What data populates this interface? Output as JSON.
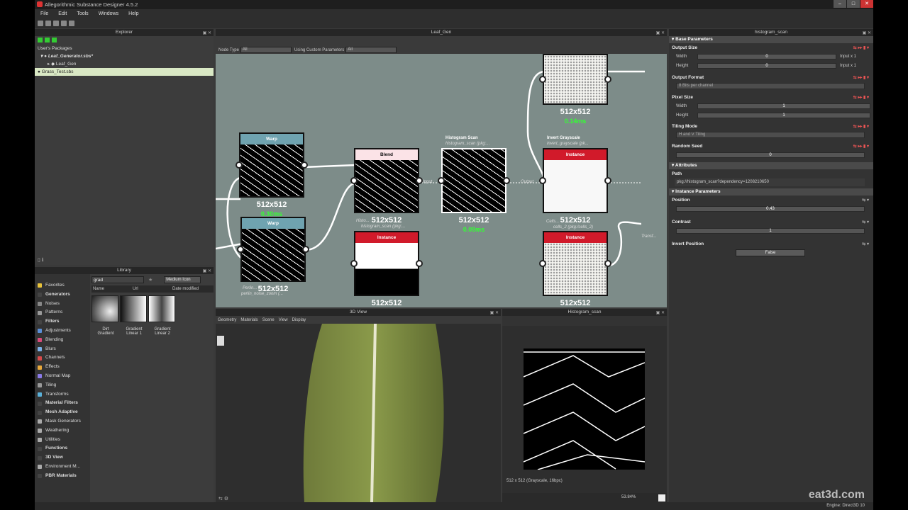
{
  "window": {
    "title": "Allegorithmic Substance Designer 4.5.2"
  },
  "menu": [
    "File",
    "Edit",
    "Tools",
    "Windows",
    "Help"
  ],
  "explorer": {
    "title": "Explorer",
    "section": "User's Packages",
    "items": [
      "Leaf_Generator.sbs*",
      "Leaf_Gen",
      "Grass_Test.sbs"
    ]
  },
  "library": {
    "title": "Library",
    "search_value": "grad",
    "view_mode": "Medium Icon",
    "columns": [
      "Name",
      "Url",
      "Date modified"
    ],
    "thumbs": [
      {
        "label": "Dirt Gradient"
      },
      {
        "label": "Gradient Linear 1"
      },
      {
        "label": "Gradient Linear 2"
      }
    ],
    "categories": [
      {
        "label": "Favorites",
        "bold": false,
        "color": "#e8c23a"
      },
      {
        "label": "Generators",
        "bold": true,
        "color": "#444"
      },
      {
        "label": "Noises",
        "bold": false,
        "color": "#888"
      },
      {
        "label": "Patterns",
        "bold": false,
        "color": "#999"
      },
      {
        "label": "Filters",
        "bold": true,
        "color": "#444"
      },
      {
        "label": "Adjustments",
        "bold": false,
        "color": "#5a8fd8"
      },
      {
        "label": "Blending",
        "bold": false,
        "color": "#d84a7a"
      },
      {
        "label": "Blurs",
        "bold": false,
        "color": "#7ab0e8"
      },
      {
        "label": "Channels",
        "bold": false,
        "color": "#d84a4a"
      },
      {
        "label": "Effects",
        "bold": false,
        "color": "#e8a83a"
      },
      {
        "label": "Normal Map",
        "bold": false,
        "color": "#8a7ae8"
      },
      {
        "label": "Tiling",
        "bold": false,
        "color": "#999"
      },
      {
        "label": "Transforms",
        "bold": false,
        "color": "#5ab0d8"
      },
      {
        "label": "Material Filters",
        "bold": true,
        "color": "#444"
      },
      {
        "label": "Mesh Adaptive",
        "bold": true,
        "color": "#444"
      },
      {
        "label": "Mask Generators",
        "bold": false,
        "color": "#aaa"
      },
      {
        "label": "Weathering",
        "bold": false,
        "color": "#aaa"
      },
      {
        "label": "Utilities",
        "bold": false,
        "color": "#aaa"
      },
      {
        "label": "Functions",
        "bold": true,
        "color": "#444"
      },
      {
        "label": "3D View",
        "bold": true,
        "color": "#444"
      },
      {
        "label": "Environment M...",
        "bold": false,
        "color": "#aaa"
      },
      {
        "label": "PBR Materials",
        "bold": true,
        "color": "#444"
      }
    ]
  },
  "graph": {
    "title": "Leaf_Gen",
    "filter_label": "Node Type",
    "filter_value": "All",
    "custom_label": "Using Custom Parameters",
    "custom_value": "All",
    "nodes": [
      {
        "title": "Warp",
        "size": "512x512",
        "time": "0.30ms"
      },
      {
        "title": "Warp",
        "size": "512x512"
      },
      {
        "title": "Blend",
        "size": "512x512"
      },
      {
        "title": "Instance",
        "size": "512x512"
      },
      {
        "label": "Histogram Scan",
        "sub": "histogram_scan (pkg:...",
        "size": "512x512",
        "time": "0.09ms"
      },
      {
        "label": "Invert Grayscale",
        "sub": "invert_grayscale (pk...",
        "title": "Instance",
        "size": "512x512"
      },
      {
        "title": "Instance",
        "size": "512x512"
      },
      {
        "size": "512x512",
        "time": "0.14ms"
      }
    ],
    "misc_labels": [
      "Histo...",
      "histogram_scan (pkg:...",
      "Perlin...",
      "perlin_noise_zoom (...",
      "Cells...",
      "cells_2 (pkg:/cells_2)",
      "Input",
      "Output",
      "Transf..."
    ]
  },
  "view3d": {
    "title": "3D View",
    "menus": [
      "Geometry",
      "Materials",
      "Scene",
      "View",
      "Display"
    ]
  },
  "view2d": {
    "title": "Histogram_scan",
    "info": "512 x 512 (Grayscale, 16bpc)",
    "zoom": "53.84%"
  },
  "params": {
    "title": "histogram_scan",
    "base_header": "Base Parameters",
    "output_size": {
      "label": "Output Size",
      "width_label": "Width",
      "width_value": "0",
      "width_mode": "Input x 1",
      "height_label": "Height",
      "height_value": "0",
      "height_mode": "Input x 1"
    },
    "output_format": {
      "label": "Output Format",
      "value": "8 Bits per channel"
    },
    "pixel_size": {
      "label": "Pixel Size",
      "width_label": "Width",
      "width_value": "1",
      "height_label": "Height",
      "height_value": "1"
    },
    "tiling": {
      "label": "Tiling Mode",
      "value": "H and V Tiling"
    },
    "seed": {
      "label": "Random Seed",
      "value": "0"
    },
    "attributes_header": "Attributes",
    "path": {
      "label": "Path",
      "value": "pkg://histogram_scan?dependency=1208210650"
    },
    "instance_header": "Instance Parameters",
    "position": {
      "label": "Position",
      "value": "0.43"
    },
    "contrast": {
      "label": "Contrast",
      "value": "1"
    },
    "invert": {
      "label": "Invert Position",
      "value": "False"
    }
  },
  "status": {
    "engine": "Engine: Direct3D 10"
  },
  "watermark": "eat3d.com"
}
